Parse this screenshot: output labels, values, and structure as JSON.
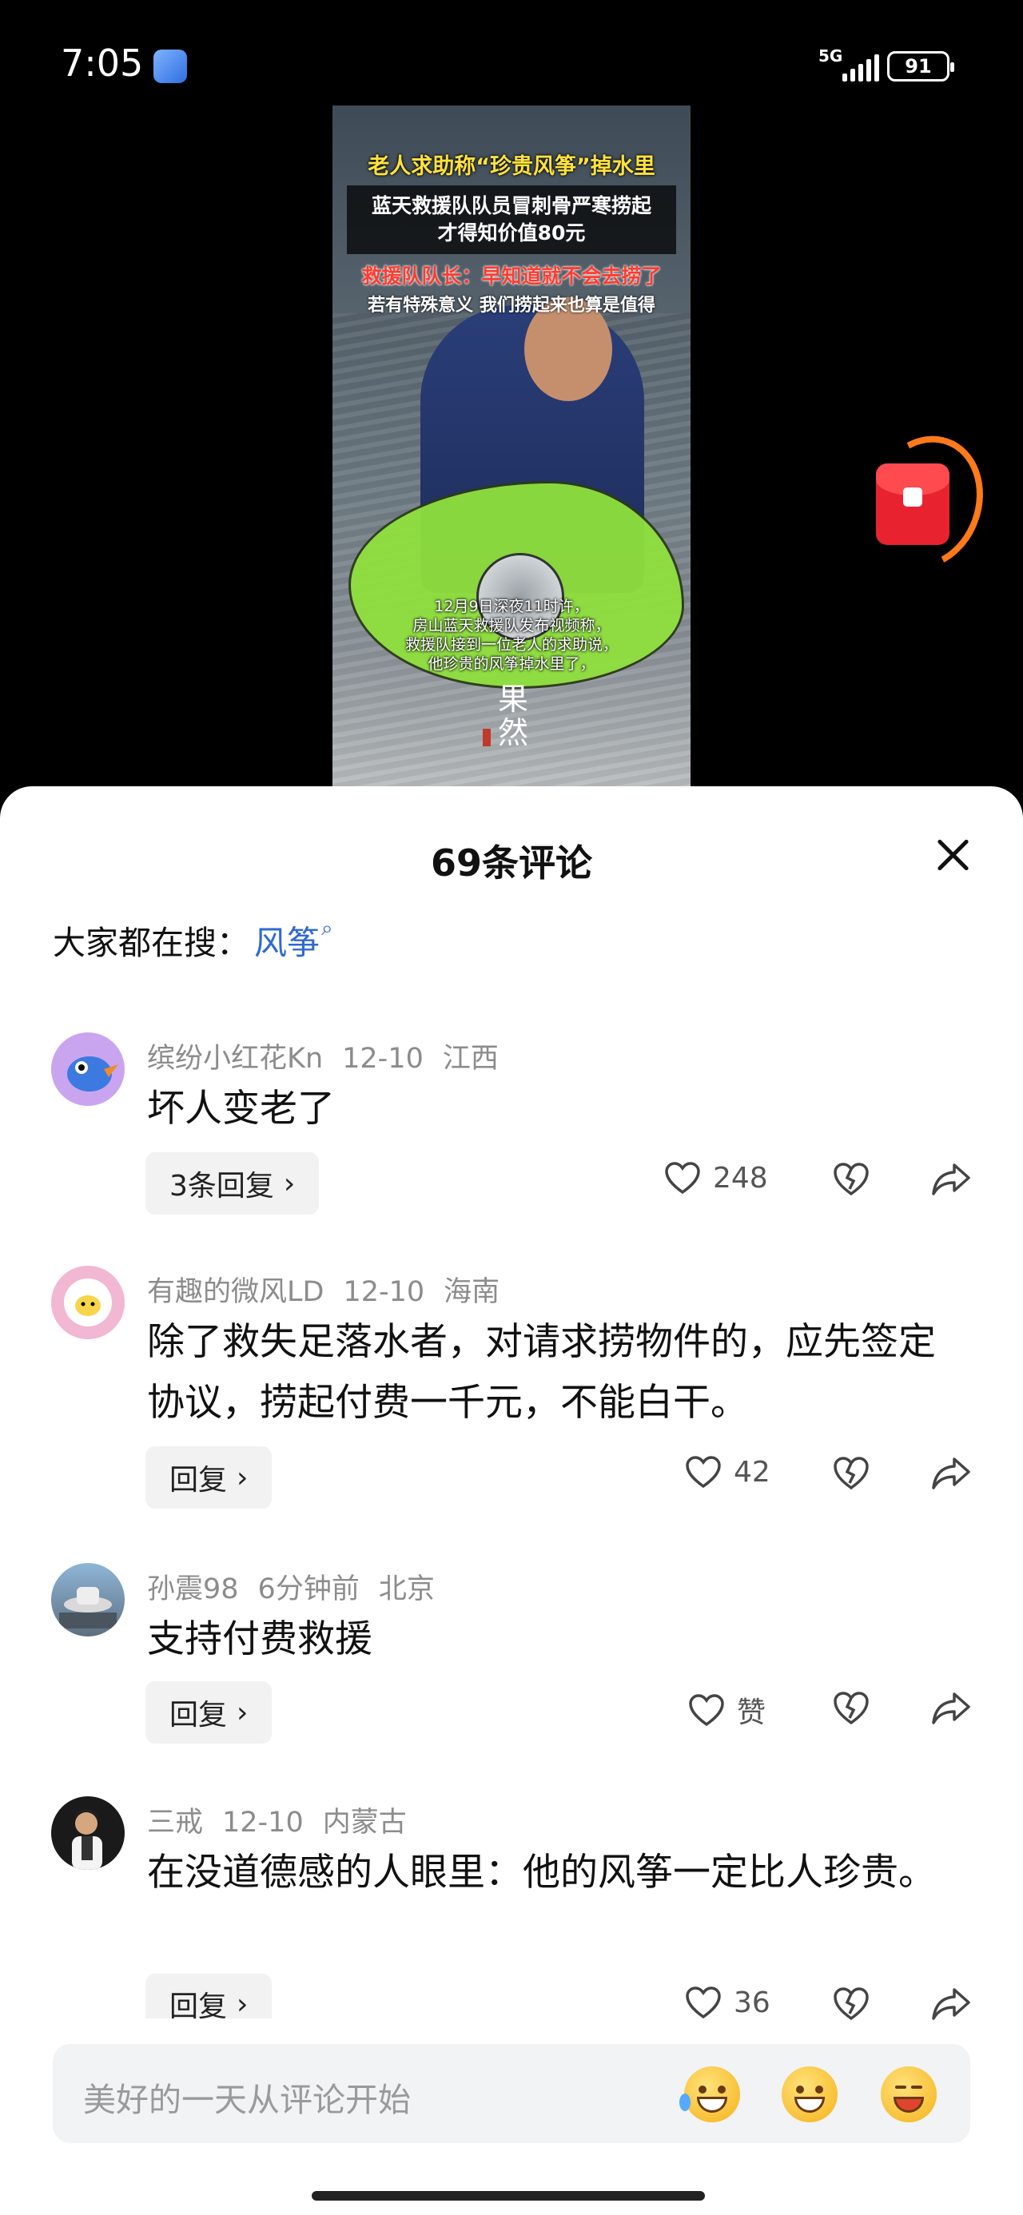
{
  "status_bar": {
    "time": "7:05",
    "network": "5G",
    "battery": "91"
  },
  "video": {
    "headline": "老人求助称“珍贵风筝”掉水里",
    "sub1": "蓝天救援队队员冒刺骨严寒捞起",
    "sub2": "才得知价值80元",
    "quote_red": "救援队队长：早知道就不会去捞了",
    "quote_white": "若有特殊意义 我们捞起来也算是值得",
    "caption": [
      "12月9日深夜11时许，",
      "房山蓝天救援队发布视频称，",
      "救援队接到一位老人的求助说，",
      "他珍贵的风筝掉水里了，"
    ],
    "watermark": "果然"
  },
  "sheet": {
    "title": "69条评论",
    "search_label": "大家都在搜：",
    "search_keyword": "风筝"
  },
  "comments": [
    {
      "user": "缤纷小红花Kn",
      "date": "12-10",
      "region": "江西",
      "text": "坏人变老了",
      "reply": "3条回复",
      "likes": "248"
    },
    {
      "user": "有趣的微风LD",
      "date": "12-10",
      "region": "海南",
      "text": "除了救失足落水者，对请求捞物件的，应先签定协议，捞起付费一千元，不能白干。",
      "reply": "回复",
      "likes": "42"
    },
    {
      "user": "孙震98",
      "date": "6分钟前",
      "region": "北京",
      "text": "支持付费救援",
      "reply": "回复",
      "likes": "赞"
    },
    {
      "user": "三戒",
      "date": "12-10",
      "region": "内蒙古",
      "text": "在没道德感的人眼里：他的风筝一定比人珍贵。",
      "reply": "回复",
      "likes": "36"
    }
  ],
  "input": {
    "placeholder": "美好的一天从评论开始"
  },
  "icons": [
    "close-icon",
    "search-icon",
    "heart-icon",
    "broken-heart-icon",
    "share-icon",
    "red-envelope-icon"
  ]
}
